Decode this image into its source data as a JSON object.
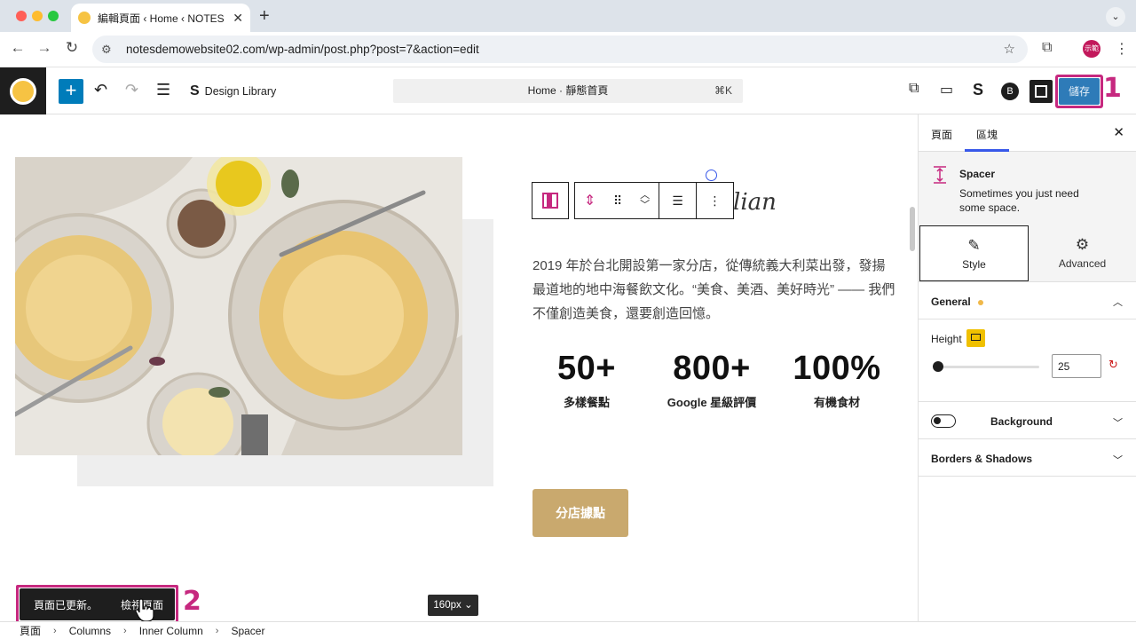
{
  "browser": {
    "tab_title": "編輯頁面 ‹ Home ‹ NOTES Ital",
    "url": "notesdemowebsite02.com/wp-admin/post.php?post=7&action=edit",
    "profile_label": "示範"
  },
  "editor": {
    "design_library": "Design Library",
    "command_title": "Home · 靜態首頁",
    "command_shortcut": "⌘K",
    "save_label": "儲存"
  },
  "annotations": {
    "badge1": "1",
    "badge2": "2"
  },
  "canvas": {
    "heading_script": "lian",
    "paragraph": "2019 年於台北開設第一家分店，從傳統義大利菜出發，發揚最道地的地中海餐飲文化。“美食、美酒、美好時光” —— 我們不僅創造美食，還要創造回憶。",
    "stats": [
      {
        "number": "50+",
        "label": "多樣餐點"
      },
      {
        "number": "800+",
        "label": "Google 星級評價"
      },
      {
        "number": "100%",
        "label": "有機食材"
      }
    ],
    "button_label": "分店據點",
    "spacer_size": "160px"
  },
  "snackbar": {
    "message": "頁面已更新。",
    "action": "檢視頁面"
  },
  "breadcrumb": [
    "頁面",
    "Columns",
    "Inner Column",
    "Spacer"
  ],
  "sidebar": {
    "tab_page": "頁面",
    "tab_block": "區塊",
    "block_name": "Spacer",
    "block_desc": "Sometimes you just need some space.",
    "style_tab": "Style",
    "advanced_tab": "Advanced",
    "general_label": "General",
    "height_label": "Height",
    "height_value": "25",
    "height_fraction": 0.02,
    "background_label": "Background",
    "borders_label": "Borders & Shadows"
  },
  "colors": {
    "accent": "#3858e9",
    "annotation": "#c6287f",
    "save_button": "#2e7bb8",
    "cta_button": "#c9a96e",
    "device_button": "#f0c000"
  }
}
